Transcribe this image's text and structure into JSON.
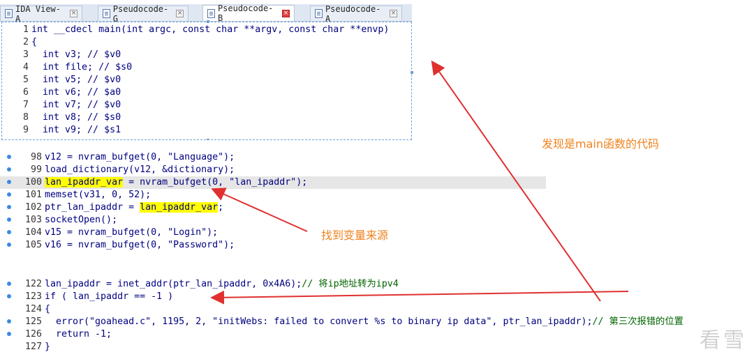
{
  "tabs": [
    {
      "label": "IDA View-A"
    },
    {
      "label": "Pseudocode-G"
    },
    {
      "label": "Pseudocode-B"
    },
    {
      "label": "Pseudocode-A"
    }
  ],
  "top_panel_lines": [
    {
      "n": "1",
      "text": "int __cdecl main(int argc, const char **argv, const char **envp)"
    },
    {
      "n": "2",
      "text": "{"
    },
    {
      "n": "3",
      "text": "  int v3; // $v0"
    },
    {
      "n": "4",
      "text": "  int file; // $s0"
    },
    {
      "n": "5",
      "text": "  int v5; // $v0"
    },
    {
      "n": "6",
      "text": "  int v6; // $a0"
    },
    {
      "n": "7",
      "text": "  int v7; // $v0"
    },
    {
      "n": "8",
      "text": "  int v8; // $s0"
    },
    {
      "n": "9",
      "text": "  int v9; // $s1"
    }
  ],
  "mid_panel_lines": [
    {
      "n": "98",
      "text": "v12 = nvram_bufget(0, \"Language\");"
    },
    {
      "n": "99",
      "text": "load_dictionary(v12, &dictionary);"
    },
    {
      "n": "100",
      "a": "lan_ipaddr_var",
      "b": " = nvram_bufget(0, \"lan_ipaddr\");"
    },
    {
      "n": "101",
      "text": "memset(v31, 0, 52);"
    },
    {
      "n": "102",
      "a": "ptr_lan_ipaddr = ",
      "b": "lan_ipaddr_var",
      ";": ";"
    },
    {
      "n": "103",
      "text": "socketOpen();"
    },
    {
      "n": "104",
      "text": "v15 = nvram_bufget(0, \"Login\");"
    },
    {
      "n": "105",
      "text": "v16 = nvram_bufget(0, \"Password\");"
    }
  ],
  "bottom_panel_lines": [
    {
      "n": "122",
      "text": "lan_ipaddr = inet_addr(ptr_lan_ipaddr, 0x4A6);",
      "cmt": "// 将ip地址转为ipv4"
    },
    {
      "n": "123",
      "text": "if ( lan_ipaddr == -1 )"
    },
    {
      "n": "124",
      "text": "{"
    },
    {
      "n": "125",
      "text": "  error(\"goahead.c\", 1195, 2, \"initWebs: failed to convert %s to binary ip data\", ptr_lan_ipaddr);",
      "cmt": "// 第三次报错的位置"
    },
    {
      "n": "126",
      "text": "  return -1;"
    },
    {
      "n": "127",
      "text": "}"
    }
  ],
  "annotations": {
    "main_note": "发现是main函数的代码",
    "source_note": "找到变量来源"
  },
  "watermark": "看雪",
  "colors": {
    "annotation": "#f0821e",
    "arrow": "#e03030",
    "highlight": "#ffff00"
  }
}
